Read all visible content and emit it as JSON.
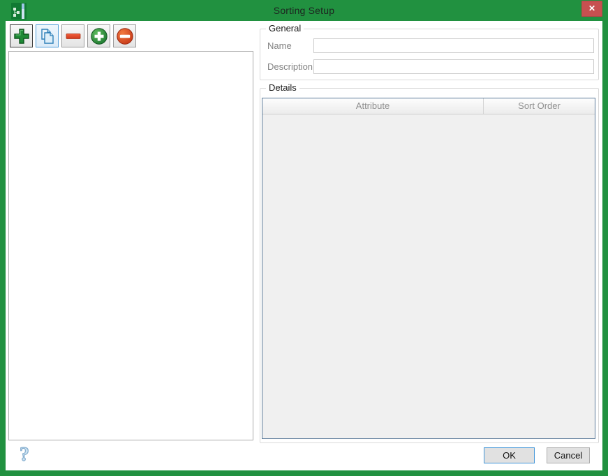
{
  "window": {
    "title": "Sorting Setup",
    "close_glyph": "✕"
  },
  "colors": {
    "titlebar_green": "#219140",
    "close_red": "#C75050",
    "table_border_blue": "#5C7B9A",
    "ok_border_blue": "#3F94D8",
    "header_text_gray": "#8f8f8f"
  },
  "toolbar": {
    "buttons": [
      {
        "icon": "add-plus-icon"
      },
      {
        "icon": "copy-icon"
      },
      {
        "icon": "remove-minus-icon"
      },
      {
        "icon": "add-circle-icon"
      },
      {
        "icon": "remove-circle-icon"
      }
    ]
  },
  "sorting_list": {
    "items": []
  },
  "general": {
    "label": "General",
    "fields": {
      "name": {
        "label": "Name",
        "value": ""
      },
      "description": {
        "label": "Description",
        "value": ""
      }
    }
  },
  "details": {
    "label": "Details",
    "table": {
      "columns": [
        "Attribute",
        "Sort Order"
      ],
      "rows": []
    }
  },
  "footer": {
    "ok_label": "OK",
    "cancel_label": "Cancel"
  }
}
